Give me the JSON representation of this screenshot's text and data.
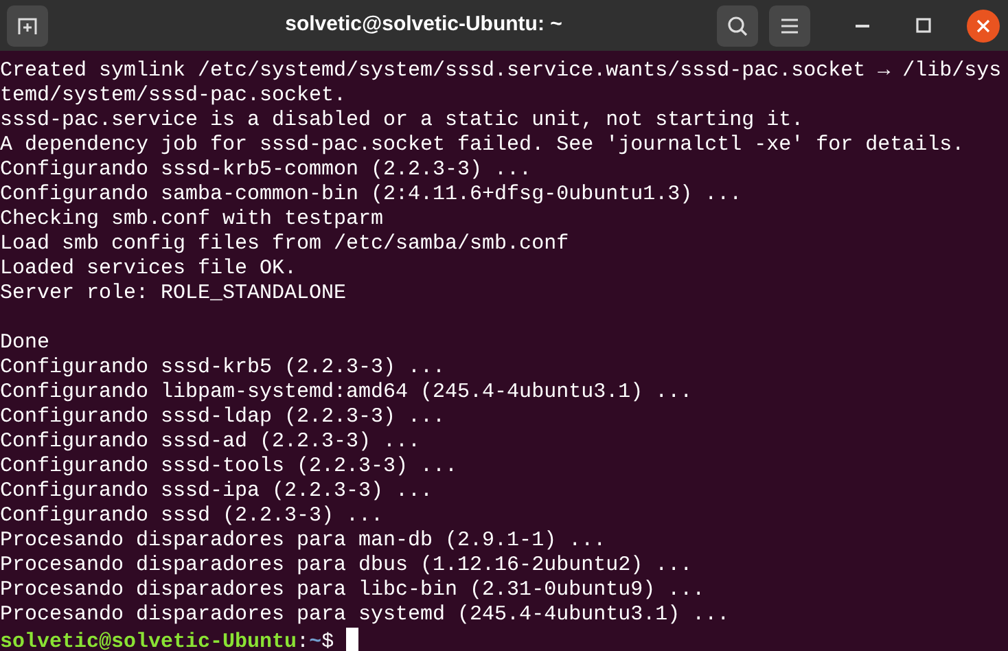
{
  "window": {
    "title": "solvetic@solvetic-Ubuntu: ~"
  },
  "terminal": {
    "lines": [
      {
        "kind": "output",
        "text": "Created symlink /etc/systemd/system/sssd.service.wants/sssd-pac.socket → /lib/systemd/system/sssd-pac.socket."
      },
      {
        "kind": "output",
        "text": "sssd-pac.service is a disabled or a static unit, not starting it."
      },
      {
        "kind": "output",
        "text": "A dependency job for sssd-pac.socket failed. See 'journalctl -xe' for details."
      },
      {
        "kind": "output",
        "text": "Configurando sssd-krb5-common (2.2.3-3) ..."
      },
      {
        "kind": "output",
        "text": "Configurando samba-common-bin (2:4.11.6+dfsg-0ubuntu1.3) ..."
      },
      {
        "kind": "output",
        "text": "Checking smb.conf with testparm"
      },
      {
        "kind": "output",
        "text": "Load smb config files from /etc/samba/smb.conf"
      },
      {
        "kind": "output",
        "text": "Loaded services file OK."
      },
      {
        "kind": "output",
        "text": "Server role: ROLE_STANDALONE"
      },
      {
        "kind": "blank"
      },
      {
        "kind": "output",
        "text": "Done"
      },
      {
        "kind": "output",
        "text": "Configurando sssd-krb5 (2.2.3-3) ..."
      },
      {
        "kind": "output",
        "text": "Configurando libpam-systemd:amd64 (245.4-4ubuntu3.1) ..."
      },
      {
        "kind": "output",
        "text": "Configurando sssd-ldap (2.2.3-3) ..."
      },
      {
        "kind": "output",
        "text": "Configurando sssd-ad (2.2.3-3) ..."
      },
      {
        "kind": "output",
        "text": "Configurando sssd-tools (2.2.3-3) ..."
      },
      {
        "kind": "output",
        "text": "Configurando sssd-ipa (2.2.3-3) ..."
      },
      {
        "kind": "output",
        "text": "Configurando sssd (2.2.3-3) ..."
      },
      {
        "kind": "output",
        "text": "Procesando disparadores para man-db (2.9.1-1) ..."
      },
      {
        "kind": "output",
        "text": "Procesando disparadores para dbus (1.12.16-2ubuntu2) ..."
      },
      {
        "kind": "output",
        "text": "Procesando disparadores para libc-bin (2.31-0ubuntu9) ..."
      },
      {
        "kind": "output",
        "text": "Procesando disparadores para systemd (245.4-4ubuntu3.1) ..."
      }
    ],
    "prompt": {
      "user_host": "solvetic@solvetic-Ubuntu",
      "separator": ":",
      "path": "~",
      "symbol": "$",
      "cursor": true
    }
  }
}
